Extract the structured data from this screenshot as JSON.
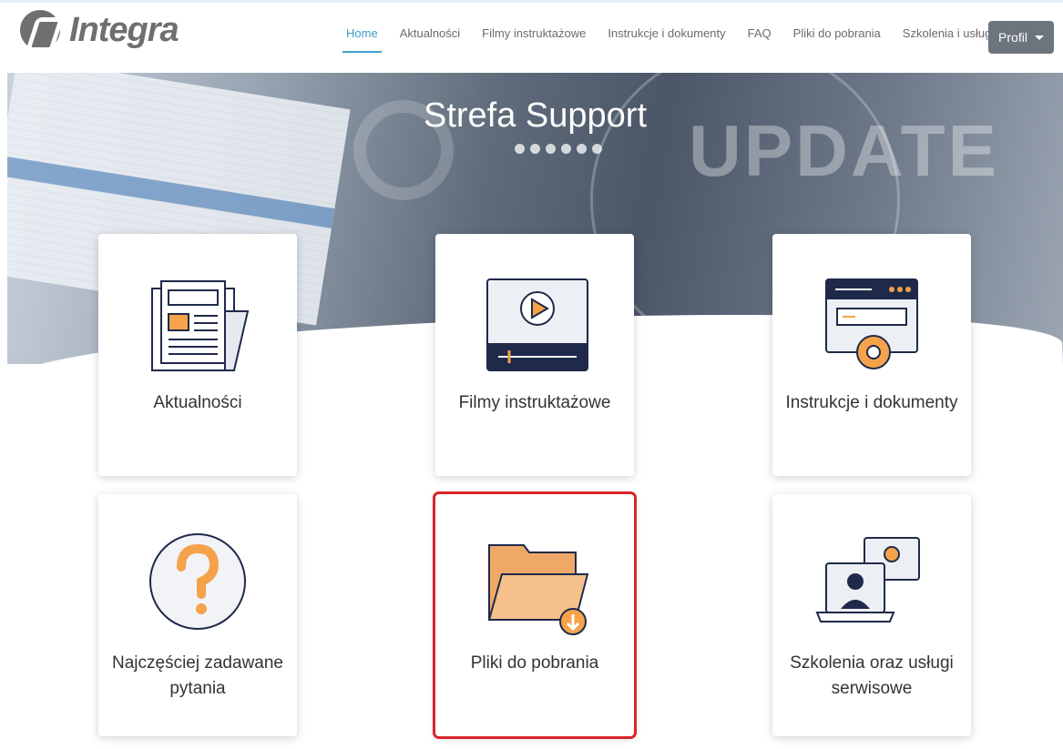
{
  "brand": {
    "name": "Integra",
    "logo_icon": "integra-logo-icon"
  },
  "nav": {
    "items": [
      {
        "label": "Home",
        "active": true
      },
      {
        "label": "Aktualności",
        "active": false
      },
      {
        "label": "Filmy instruktażowe",
        "active": false
      },
      {
        "label": "Instrukcje i dokumenty",
        "active": false
      },
      {
        "label": "FAQ",
        "active": false
      },
      {
        "label": "Pliki do pobrania",
        "active": false
      },
      {
        "label": "Szkolenia i usługi",
        "active": false
      }
    ],
    "profile_label": "Profil"
  },
  "hero": {
    "title": "Strefa Support",
    "background_word": "UPDATE"
  },
  "cards": [
    {
      "label": "Aktualności",
      "icon": "newspaper-icon"
    },
    {
      "label": "Filmy instruktażowe",
      "icon": "video-player-icon"
    },
    {
      "label": "Instrukcje i dokumenty",
      "icon": "browser-gear-icon"
    },
    {
      "label": "Najczęściej zadawane pytania",
      "icon": "question-mark-icon"
    },
    {
      "label": "Pliki do pobrania",
      "icon": "folder-download-icon",
      "highlighted": true
    },
    {
      "label": "Szkolenia oraz usługi serwisowe",
      "icon": "training-service-icon"
    }
  ],
  "colors": {
    "accent": "#3aa0c9",
    "highlight": "#d9252a",
    "orange": "#f5a24b",
    "navy": "#1f2a4a",
    "button": "#6c757d"
  }
}
